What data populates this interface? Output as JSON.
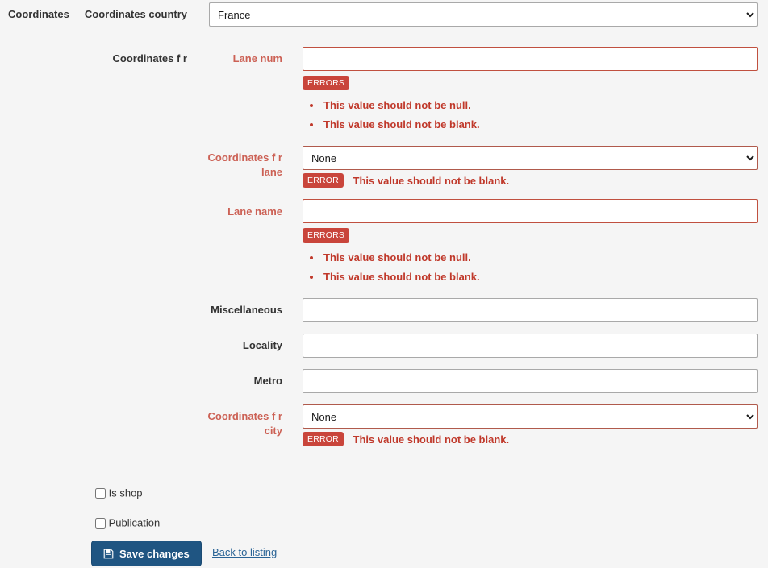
{
  "section": {
    "label": "Coordinates"
  },
  "fields": {
    "country": {
      "label": "Coordinates country",
      "value": "France",
      "options": [
        "France"
      ]
    },
    "group_fr": {
      "outer_label": "Coordinates f r",
      "lane_num": {
        "label": "Lane num",
        "value": "",
        "errors_badge": "ERRORS",
        "errors": [
          "This value should not be null.",
          "This value should not be blank."
        ]
      },
      "fr_lane": {
        "label": "Coordinates f r lane",
        "value": "None",
        "options": [
          "None"
        ],
        "error_badge": "ERROR",
        "error_message": "This value should not be blank."
      },
      "lane_name": {
        "label": "Lane name",
        "value": "",
        "errors_badge": "ERRORS",
        "errors": [
          "This value should not be null.",
          "This value should not be blank."
        ]
      },
      "miscellaneous": {
        "label": "Miscellaneous",
        "value": ""
      },
      "locality": {
        "label": "Locality",
        "value": ""
      },
      "metro": {
        "label": "Metro",
        "value": ""
      },
      "fr_city": {
        "label": "Coordinates f r city",
        "value": "None",
        "options": [
          "None"
        ],
        "error_badge": "ERROR",
        "error_message": "This value should not be blank."
      }
    },
    "is_shop": {
      "label": "Is shop",
      "checked": false
    },
    "publication": {
      "label": "Publication",
      "checked": false
    }
  },
  "actions": {
    "save_label": "Save changes",
    "back_label": "Back to listing"
  },
  "colors": {
    "error_red": "#c0392b",
    "badge_red": "#c9453b",
    "label_error": "#cc6155",
    "primary_blue": "#1f5582",
    "link_blue": "#2a6496",
    "page_bg": "#f5f5f5"
  }
}
